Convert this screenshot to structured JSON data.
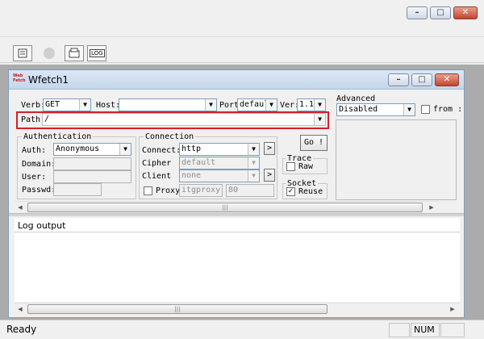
{
  "window": {
    "min_glyph": "–",
    "max_glyph": "□",
    "close_glyph": "✕"
  },
  "toolbar": {
    "log_button_label": "LOG"
  },
  "child": {
    "title": "Wfetch1",
    "icon_text": "Web\nFetch",
    "min_glyph": "–",
    "max_glyph": "□",
    "close_glyph": "✕"
  },
  "request": {
    "verb_label": "Verb:",
    "verb_value": "GET",
    "host_label": "Host:",
    "host_value": "",
    "port_label": "Port",
    "port_value": "defaul",
    "ver_label": "Ver:",
    "ver_value": "1.1",
    "path_label": "Path:",
    "path_value": "/"
  },
  "advanced": {
    "label": "Advanced",
    "value": "Disabled",
    "from_label": "from :"
  },
  "auth": {
    "group_label": "Authentication",
    "auth_label": "Auth:",
    "auth_value": "Anonymous",
    "domain_label": "Domain:",
    "user_label": "User:",
    "passwd_label": "Passwd:"
  },
  "connection": {
    "group_label": "Connection",
    "connect_label": "Connect:",
    "connect_value": "http",
    "cipher_label": "Cipher",
    "cipher_value": "default",
    "client_label": "Client",
    "client_value": "none",
    "proxy_label": "Proxy",
    "proxy_host": "itgproxy",
    "proxy_port": "80"
  },
  "go_button": "Go !",
  "trace": {
    "label": "Trace",
    "raw_label": "Raw",
    "raw_checked": false
  },
  "socket": {
    "label": "Socket",
    "reuse_label": "Reuse",
    "reuse_checked": true
  },
  "log": {
    "label": "Log output"
  },
  "status": {
    "text": "Ready",
    "num": "NUM"
  },
  "icons": {
    "checkmark": "✓",
    "arrow_down": "▼",
    "arrow_left": "◀",
    "arrow_right": "▶",
    "arrow_right_small": ">",
    "grip": "|||"
  }
}
